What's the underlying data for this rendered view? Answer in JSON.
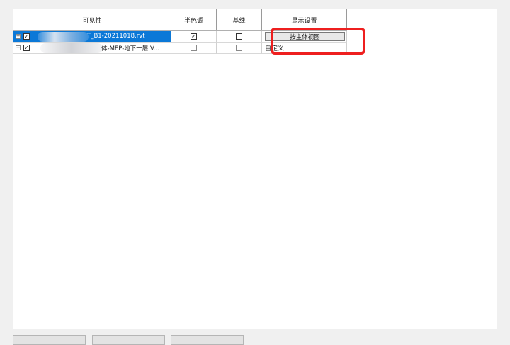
{
  "columns": {
    "visibility": "可见性",
    "halftone": "半色调",
    "baseline": "基线",
    "display_settings": "显示设置"
  },
  "rows": [
    {
      "expander": "+",
      "visible": true,
      "name": "T_B1-20211018.rvt",
      "halftone": true,
      "baseline": false,
      "display": "按主体视图",
      "selected": true
    },
    {
      "expander": "+",
      "visible": true,
      "name": "体-MEP-地下一层 V...",
      "halftone": false,
      "baseline": false,
      "display": "自定义",
      "selected": false
    }
  ],
  "colors": {
    "selection": "#0b78d7",
    "highlight_box": "#ee1f1f"
  }
}
